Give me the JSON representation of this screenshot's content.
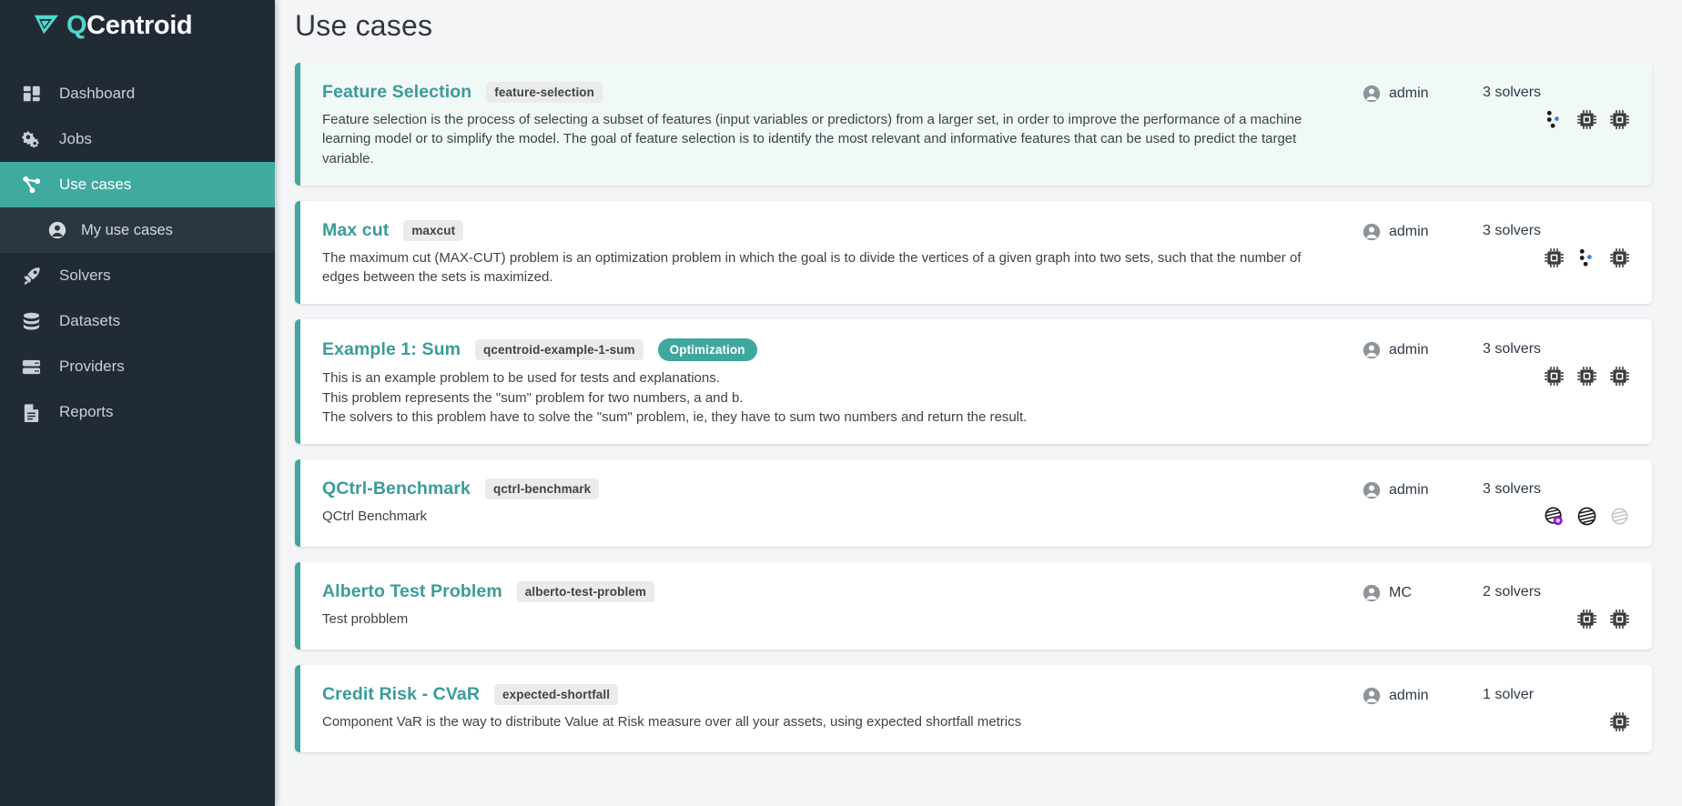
{
  "brand": {
    "logo_q": "Q",
    "logo_rest": "Centroid",
    "logo_icon": "qcentroid-arrow-logo",
    "accent": "#3fa79e",
    "sidebar_bg": "#212b36"
  },
  "sidebar": {
    "items": [
      {
        "label": "Dashboard",
        "icon": "grid-icon",
        "active": false,
        "sub": false
      },
      {
        "label": "Jobs",
        "icon": "gears-icon",
        "active": false,
        "sub": false
      },
      {
        "label": "Use cases",
        "icon": "share-nodes-icon",
        "active": true,
        "sub": false
      },
      {
        "label": "My use cases",
        "icon": "user-circle-icon",
        "active": false,
        "sub": true
      },
      {
        "label": "Solvers",
        "icon": "rocket-icon",
        "active": false,
        "sub": false
      },
      {
        "label": "Datasets",
        "icon": "database-icon",
        "active": false,
        "sub": false
      },
      {
        "label": "Providers",
        "icon": "server-icon",
        "active": false,
        "sub": false
      },
      {
        "label": "Reports",
        "icon": "document-icon",
        "active": false,
        "sub": false
      }
    ]
  },
  "header": {
    "title": "Use cases"
  },
  "cards": [
    {
      "title": "Feature Selection",
      "slug": "feature-selection",
      "type": null,
      "highlight": true,
      "wrap": true,
      "description_lines": [
        "Feature selection is the process of selecting a subset of features (input variables or predictors) from a larger set, in order to improve the performance of a machine learning model or to simplify the model. The goal of feature selection is to identify the most relevant and informative features that can be used to predict the target variable."
      ],
      "owner": "admin",
      "solver_count": "3 solvers",
      "solver_icons": [
        "dwave-dots-icon",
        "cpu-chip-icon",
        "cpu-chip-icon"
      ]
    },
    {
      "title": "Max cut",
      "slug": "maxcut",
      "type": null,
      "highlight": false,
      "wrap": true,
      "description_lines": [
        "The maximum cut (MAX-CUT) problem is an optimization problem in which the goal is to divide the vertices of a given graph into two sets, such that the number of edges between the sets is maximized."
      ],
      "owner": "admin",
      "solver_count": "3 solvers",
      "solver_icons": [
        "cpu-chip-icon",
        "dwave-dots-icon",
        "cpu-chip-icon"
      ]
    },
    {
      "title": "Example 1: Sum",
      "slug": "qcentroid-example-1-sum",
      "type": "Optimization",
      "highlight": false,
      "wrap": false,
      "description_lines": [
        "This is an example problem to be used for tests and explanations.",
        "This problem represents the \"sum\" problem for two numbers, a and b.",
        "The solvers to this problem have to solve the \"sum\" problem, ie, they have to sum two numbers and return the result."
      ],
      "owner": "admin",
      "solver_count": "3 solvers",
      "solver_icons": [
        "cpu-chip-icon",
        "cpu-chip-icon",
        "cpu-chip-icon"
      ]
    },
    {
      "title": "QCtrl-Benchmark",
      "slug": "qctrl-benchmark",
      "type": null,
      "highlight": false,
      "wrap": false,
      "description_lines": [
        "QCtrl Benchmark"
      ],
      "owner": "admin",
      "solver_count": "3 solvers",
      "solver_icons": [
        "ibm-globe-active-icon",
        "ibm-globe-icon",
        "ibm-globe-muted-icon"
      ]
    },
    {
      "title": "Alberto Test Problem",
      "slug": "alberto-test-problem",
      "type": null,
      "highlight": false,
      "wrap": false,
      "description_lines": [
        "Test probblem"
      ],
      "owner": "MC",
      "solver_count": "2 solvers",
      "solver_icons": [
        "cpu-chip-icon",
        "cpu-chip-icon"
      ]
    },
    {
      "title": "Credit Risk - CVaR",
      "slug": "expected-shortfall",
      "type": null,
      "highlight": false,
      "wrap": false,
      "description_lines": [
        "Component VaR is the way to distribute Value at Risk measure over all your assets, using expected shortfall metrics"
      ],
      "owner": "admin",
      "solver_count": "1 solver",
      "solver_icons": [
        "cpu-chip-icon"
      ]
    }
  ]
}
